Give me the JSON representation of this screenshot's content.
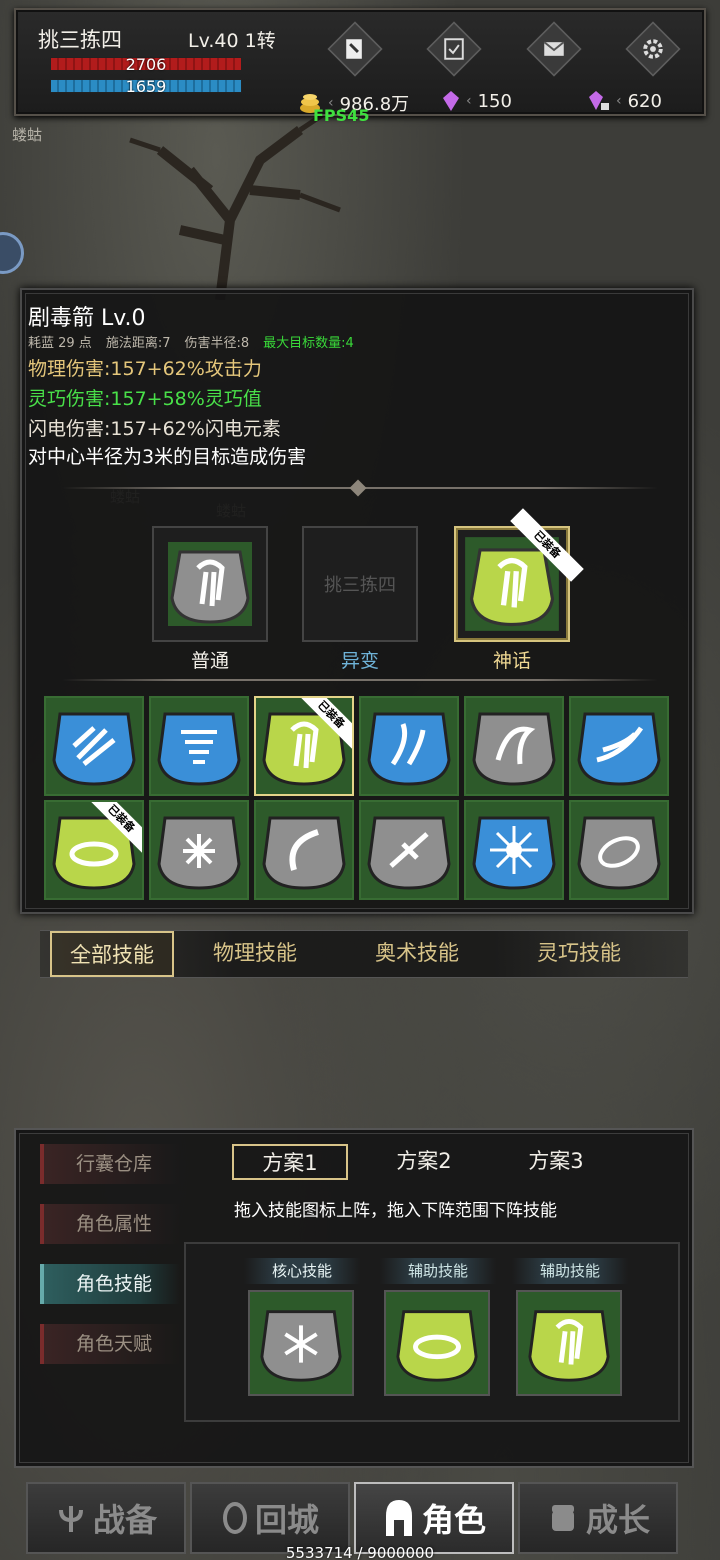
{
  "hud": {
    "player_name": "挑三拣四",
    "player_level": "Lv.40 1转",
    "hp": "2706",
    "mp": "1659",
    "gold": "986.8万",
    "gem": "150",
    "crystal": "620",
    "fps": "FPS45",
    "icons": [
      "skillbook-icon",
      "task-icon",
      "mail-icon",
      "gear-icon"
    ]
  },
  "scene": {
    "labels": [
      "蝼蛄",
      "蝼蛄",
      "蝼蛄"
    ]
  },
  "skill_detail": {
    "title": "剧毒箭 Lv.0",
    "cost": "耗蓝 29 点",
    "range": "施法距离:7",
    "radius": "伤害半径:8",
    "max_targets": "最大目标数量:4",
    "physical": "物理伤害:157+62%攻击力",
    "agile": "灵巧伤害:157+58%灵巧值",
    "lightning": "闪电伤害:157+62%闪电元素",
    "description": "对中心半径为3米的目标造成伤害",
    "rune_slots": {
      "normal": "普通",
      "mutant": "异变",
      "myth": "神话",
      "mutant_watermark": "挑三拣四"
    },
    "equipped_tag": "已装备"
  },
  "category_tabs": [
    "全部技能",
    "物理技能",
    "奥术技能",
    "灵巧技能"
  ],
  "char_panel": {
    "side_tabs": [
      "行囊仓库",
      "角色属性",
      "角色技能",
      "角色天赋"
    ],
    "plans": [
      "方案1",
      "方案2",
      "方案3"
    ],
    "hint": "拖入技能图标上阵，拖入下阵范围下阵技能",
    "slot_heads": [
      "核心技能",
      "辅助技能",
      "辅助技能"
    ]
  },
  "nav": [
    "战备",
    "回城",
    "角色",
    "成长"
  ],
  "xp": "5533714 / 9000000",
  "colors": {
    "gold_text": "#d8c489",
    "green_text": "#49e049",
    "rune_green": "#2d5a2a",
    "rune_gray": "#8f8f8f",
    "rune_blue": "#3a8fd8",
    "rune_yellow": "#b9d64a"
  }
}
